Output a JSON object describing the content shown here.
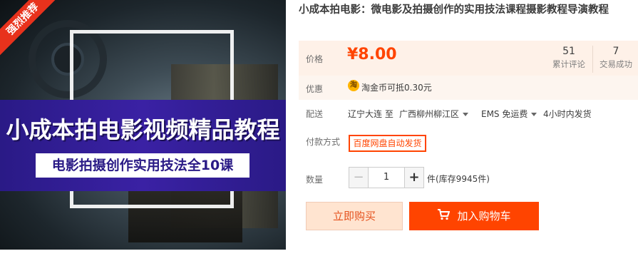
{
  "image": {
    "badge": "强烈推荐",
    "banner_title": "小成本拍电影视频精品教程",
    "banner_subtitle": "电影拍摄创作实用技法全10课"
  },
  "product": {
    "title": "小成本拍电影：微电影及拍摄创作的实用技法课程摄影教程导演教程"
  },
  "price": {
    "label": "价格",
    "value": "¥8.00",
    "stats": [
      {
        "num": "51",
        "label": "累计评论"
      },
      {
        "num": "7",
        "label": "交易成功"
      }
    ]
  },
  "promo": {
    "label": "优惠",
    "coin_icon": "淘",
    "text": "淘金币可抵0.30元"
  },
  "shipping": {
    "label": "配送",
    "from": "辽宁大连 至",
    "to": "广西柳州柳江区",
    "method": "EMS 免运费",
    "time": "4小时内发货"
  },
  "payment": {
    "label": "付款方式",
    "option": "百度网盘自动发货"
  },
  "quantity": {
    "label": "数量",
    "minus": "−",
    "value": "1",
    "plus": "+",
    "stock": "件(库存9945件)"
  },
  "actions": {
    "buy_now": "立即购买",
    "add_to_cart": "加入购物车"
  },
  "colors": {
    "accent": "#ff4400",
    "price_bg": "#fef1e8",
    "banner": "#2a1a86"
  }
}
